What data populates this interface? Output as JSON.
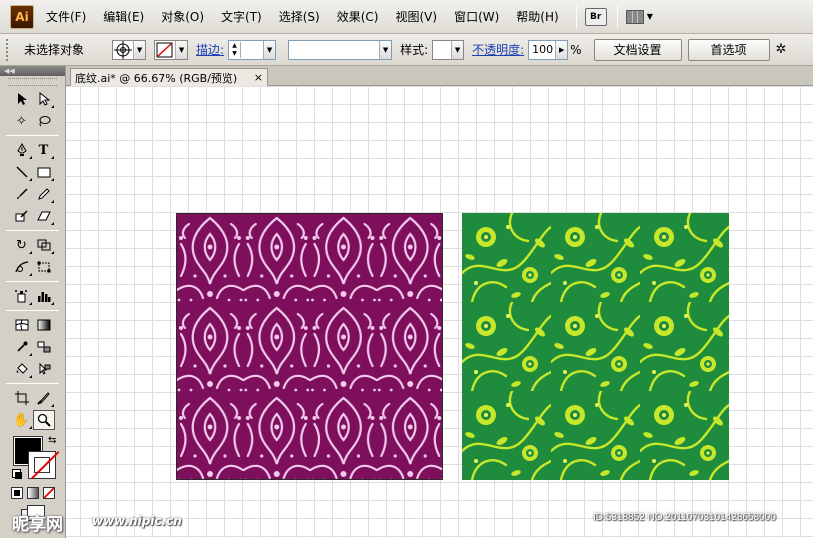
{
  "app": {
    "logo": "Ai"
  },
  "menu": [
    {
      "label": "文件(F)"
    },
    {
      "label": "编辑(E)"
    },
    {
      "label": "对象(O)"
    },
    {
      "label": "文字(T)"
    },
    {
      "label": "选择(S)"
    },
    {
      "label": "效果(C)"
    },
    {
      "label": "视图(V)"
    },
    {
      "label": "窗口(W)"
    },
    {
      "label": "帮助(H)"
    }
  ],
  "menu_tools": {
    "bridge_label": "Br",
    "bridge_icon": "bridge-icon",
    "arrange_icon": "arrange-documents-icon"
  },
  "control": {
    "selection_status": "未选择对象",
    "stroke_label": "描边:",
    "style_label": "样式:",
    "opacity_label": "不透明度:",
    "opacity_value": "100",
    "opacity_unit": "%",
    "doc_setup_button": "文档设置",
    "preferences_button": "首选项"
  },
  "document": {
    "tab_title": "底纹.ai* @ 66.67% (RGB/预览)",
    "close_glyph": "×"
  },
  "tools": [
    [
      "selection-tool-icon",
      "direct-selection-tool-icon"
    ],
    [
      "magic-wand-tool-icon",
      "lasso-tool-icon"
    ],
    [
      "pen-tool-icon",
      "type-tool-icon"
    ],
    [
      "line-segment-tool-icon",
      "rectangle-tool-icon"
    ],
    [
      "paintbrush-tool-icon",
      "pencil-tool-icon"
    ],
    [
      "blob-brush-tool-icon",
      "eraser-tool-icon"
    ],
    [
      "rotate-tool-icon",
      "scale-tool-icon"
    ],
    [
      "warp-tool-icon",
      "free-transform-tool-icon"
    ],
    [
      "symbol-sprayer-tool-icon",
      "column-graph-tool-icon"
    ],
    [
      "mesh-tool-icon",
      "gradient-tool-icon"
    ],
    [
      "eyedropper-tool-icon",
      "blend-tool-icon"
    ],
    [
      "live-paint-bucket-tool-icon",
      "live-paint-selection-tool-icon"
    ],
    [
      "crop-area-tool-icon",
      "slice-tool-icon"
    ],
    [
      "hand-tool-icon",
      "zoom-tool-icon"
    ]
  ],
  "colors": {
    "fill": "#000000",
    "damask_bg": "#7d0f5c",
    "damask_fg": "#f3c9ec",
    "floral_bg": "#1f8b3c",
    "floral_fg": "#c7e82a"
  },
  "watermark": {
    "logo": "昵享网",
    "url": "www.nipic.cn",
    "id": "ID:5318852 NO:20110703101428658000"
  }
}
